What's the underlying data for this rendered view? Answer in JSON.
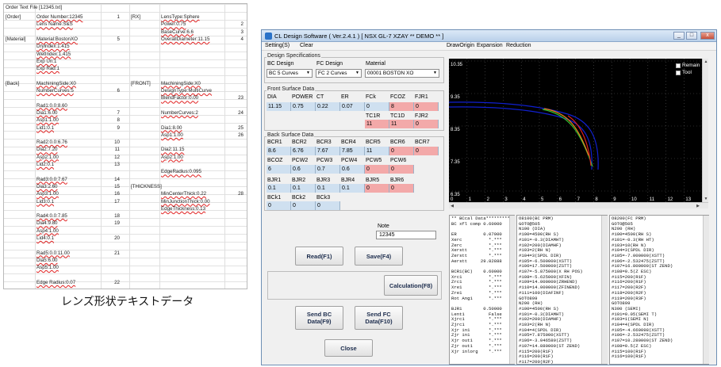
{
  "sheet": {
    "title": "Order Text File [12345.txt]",
    "rows": [
      {
        "a": "[Order]",
        "b": "Order Number:12345",
        "n": "1",
        "c": "[RX]",
        "d": "LensType:Sphere",
        "e": ""
      },
      {
        "a": "",
        "b": "Lens Name:S&S",
        "n": "",
        "c": "",
        "d": "Power:0.75",
        "e": "2"
      },
      {
        "a": "",
        "b": "",
        "n": "",
        "c": "",
        "d": "BaseCurve:6.6",
        "e": "3"
      },
      {
        "a": "[Material]",
        "b": "Material:BostonXO",
        "n": "5",
        "c": "",
        "d": "OverallDiameter:11.15",
        "e": "4"
      },
      {
        "a": "",
        "b": "Drylndex:1.415",
        "n": "",
        "c": "",
        "d": "",
        "e": ""
      },
      {
        "a": "",
        "b": "WetIndex:1.415",
        "n": "",
        "c": "",
        "d": "",
        "e": ""
      },
      {
        "a": "",
        "b": "Exp Un:1",
        "n": "",
        "c": "",
        "d": "",
        "e": ""
      },
      {
        "a": "",
        "b": "Exp Rad:1",
        "n": "",
        "c": "",
        "d": "",
        "e": ""
      },
      {
        "a": "",
        "b": "",
        "n": "",
        "c": "",
        "d": "",
        "e": ""
      },
      {
        "a": "[Back]",
        "b": "MachiningSide:X0",
        "n": "",
        "c": "[FRONT]",
        "d": "MachiningSide:X0",
        "e": ""
      },
      {
        "a": "",
        "b": "NumberCurves:5",
        "n": "6",
        "c": "",
        "d": "DesignType:MultiCurve",
        "e": ""
      },
      {
        "a": "",
        "b": "",
        "n": "",
        "c": "",
        "d": "BlendFactor:0.00",
        "e": "23"
      },
      {
        "a": "",
        "b": "Rad1:0.0:8.60",
        "n": "",
        "c": "",
        "d": "",
        "e": ""
      },
      {
        "a": "",
        "b": "Dia1:6.00",
        "n": "7",
        "c": "",
        "d": "NumberCurves:2",
        "e": "24"
      },
      {
        "a": "",
        "b": "Asp1:1.00",
        "n": "8",
        "c": "",
        "d": "",
        "e": ""
      },
      {
        "a": "",
        "b": "Lid1:0.1",
        "n": "9",
        "c": "",
        "d": "Dia1:8.00",
        "e": "25"
      },
      {
        "a": "",
        "b": "",
        "n": "",
        "c": "",
        "d": "Asp1:1.00",
        "e": "26"
      },
      {
        "a": "",
        "b": "Rad2:0.0:6.76",
        "n": "10",
        "c": "",
        "d": "",
        "e": ""
      },
      {
        "a": "",
        "b": "Dia2:7.20",
        "n": "11",
        "c": "",
        "d": "Dia2:11.15",
        "e": ""
      },
      {
        "a": "",
        "b": "Asp2:1.00",
        "n": "12",
        "c": "",
        "d": "Asp2:1.00",
        "e": ""
      },
      {
        "a": "",
        "b": "Lid2:0.1",
        "n": "13",
        "c": "",
        "d": "",
        "e": ""
      },
      {
        "a": "",
        "b": "",
        "n": "",
        "c": "",
        "d": "EdgeRadius:0.095",
        "e": ""
      },
      {
        "a": "",
        "b": "Rad3:0.0:7.67",
        "n": "14",
        "c": "",
        "d": "",
        "e": ""
      },
      {
        "a": "",
        "b": "Dia3:2.60",
        "n": "15",
        "c": "[THICKNESS]",
        "d": "",
        "e": ""
      },
      {
        "a": "",
        "b": "Asp3:1.00",
        "n": "16",
        "c": "",
        "d": "MinCenterThick:0.22",
        "e": "28"
      },
      {
        "a": "",
        "b": "Lid3:0.1",
        "n": "17",
        "c": "",
        "d": "MinJunctionThick:0.00",
        "e": ""
      },
      {
        "a": "",
        "b": "",
        "n": "",
        "c": "",
        "d": "EdgeThickness:0.13",
        "e": ""
      },
      {
        "a": "",
        "b": "Rad4:0.0:7.85",
        "n": "18",
        "c": "",
        "d": "",
        "e": ""
      },
      {
        "a": "",
        "b": "Dia4:9.80",
        "n": "19",
        "c": "",
        "d": "",
        "e": ""
      },
      {
        "a": "",
        "b": "Asp4:1.00",
        "n": "",
        "c": "",
        "d": "",
        "e": ""
      },
      {
        "a": "",
        "b": "Lid4:0.1",
        "n": "20",
        "c": "",
        "d": "",
        "e": ""
      },
      {
        "a": "",
        "b": "",
        "n": "",
        "c": "",
        "d": "",
        "e": ""
      },
      {
        "a": "",
        "b": "Rad5:0.0:11.00",
        "n": "21",
        "c": "",
        "d": "",
        "e": ""
      },
      {
        "a": "",
        "b": "Dia5:6.00",
        "n": "",
        "c": "",
        "d": "",
        "e": ""
      },
      {
        "a": "",
        "b": "Asp5:1.00",
        "n": "",
        "c": "",
        "d": "",
        "e": ""
      },
      {
        "a": "",
        "b": "",
        "n": "",
        "c": "",
        "d": "",
        "e": ""
      },
      {
        "a": "",
        "b": "Edge Radius:0.07",
        "n": "22",
        "c": "",
        "d": "",
        "e": ""
      }
    ]
  },
  "caption": "レンズ形状テキストデータ",
  "window": {
    "title": "CL Design Software ( Ver.2.4.1 )  [ NSX GL-7 XZAY ** DEMO ** ]",
    "buttons": {
      "min": "_",
      "max": "□",
      "close": "x"
    },
    "menu_left": [
      "Setting(S)",
      "Clear"
    ],
    "menu_right": [
      "DrawOrigin",
      "Expansion",
      "Reduction"
    ],
    "spec": {
      "group": "Design Specifications",
      "bc_label": "BC Design",
      "fc_label": "FC Design",
      "mat_label": "Material",
      "bc_value": "BC 5 Curves",
      "fc_value": "FC 2 Curves",
      "mat_value": "00001 BOSTON XO"
    },
    "front": {
      "group": "Front Surface Data",
      "headers": [
        "DIA",
        "POWER",
        "CT",
        "ER",
        "FCk",
        "FCOZ",
        "FJR1"
      ],
      "values": [
        "11.15",
        "0.75",
        "0.22",
        "0.07",
        "0",
        "8",
        "0"
      ],
      "headers2": [
        "TC1R",
        "TC1D",
        "FJR2"
      ],
      "values2": [
        "11",
        "11",
        "0"
      ]
    },
    "back": {
      "group": "Back Surface Data",
      "bcr_headers": [
        "BCR1",
        "BCR2",
        "BCR3",
        "BCR4",
        "BCR5",
        "BCR6",
        "BCR7"
      ],
      "bcr_values": [
        "8.6",
        "6.76",
        "7.67",
        "7.85",
        "11",
        "0",
        "0"
      ],
      "bcoz_headers": [
        "BCOZ",
        "PCW2",
        "PCW3",
        "PCW4",
        "PCW5",
        "PCW6"
      ],
      "bcoz_values": [
        "6",
        "0.6",
        "0.7",
        "0.6",
        "0",
        "0"
      ],
      "bjr_headers": [
        "BJR1",
        "BJR2",
        "BJR3",
        "BJR4",
        "BJR5",
        "BJR6"
      ],
      "bjr_values": [
        "0.1",
        "0.1",
        "0.1",
        "0.1",
        "0",
        "0"
      ],
      "bck_headers": [
        "BCk1",
        "BCk2",
        "BCk3"
      ],
      "bck_values": [
        "0",
        "0",
        "0"
      ]
    },
    "note": {
      "label": "Note",
      "value": "12345"
    },
    "actions": {
      "read": "Read(F1)",
      "save": "Save(F4)",
      "calc": "Calculation(F8)",
      "send_bc": "Send BC\nData(F9)",
      "send_fc": "Send FC\nData(F10)",
      "close": "Close"
    },
    "plot": {
      "remain": "Remain",
      "tool": "Tool",
      "y_ticks": [
        "10.35",
        "9.35",
        "8.35",
        "7.35",
        "6.35"
      ],
      "x_ticks": [
        "0",
        "1",
        "2",
        "3",
        "4",
        "5",
        "6",
        "7",
        "8",
        "9",
        "10",
        "11",
        "12",
        "13",
        "14"
      ],
      "colors": {
        "blue": "#1020d0",
        "orange": "#f08020",
        "green": "#30c030",
        "red": "#e02020"
      }
    },
    "pane1": "** BCcal Data*********\nBC xfl comp 0.60000\n\nER          0.07000\nXerc          *.***\nZerc          *.***\nXerstt        *.***\nZerstt        *.***\nAerstt     29.82888\n\nBCR1(BC)    0.60000\nXrc1          *.***\nZrc1          *.***\nXre1          *.***\nZre1          *.***\nRot Ang1      *.***\n\nBJR1        0.50000\nLent1         False\nXjrc1         *.***\nZjrc1         *.***\nXjr in1       *.***\nZjr in1       *.***\nXjr out1      *.***\nZjr out1      *.***\nXjr inlorg    *.***",
    "pane2": "O8100(BC PRM)\nGOTO@505\nN100 (DIA)\n#100=4500(RH S)\n#101=-0.3(DIAMHT)\n#102=200(DIAMHF)\n#103=2(RH N)\n#104=3(SPDL DIR)\n#105=-6.500000(XSTT)\n#106=17.500000(ZSTT)\n#107=-5.875000(X RH POS)\n#108=-5.625000(XFIN)\n#109=14.000000(ZRHEND)\n#110=14.000000(ZFINEND)\n#111=100(DIAFINF)\nGOTO899\nN200 (RH)\n#100=4500(RH S)\n#101=-0.3(DIAMHT)\n#102=200(DIAMHF)\n#103=2(RH N)\n#104=4(SPDL DIR)\n#105=7.875000(XSTT)\n#106=-3.046589(ZSTT)\n#107=14.880000(ST ZEND)\n#115=200(R1F)\n#116=200(R1F)\n#117=200(R2F)",
    "pane3": "O8200(FC PRM)\nGOTO@505\nN200 (RH)\n#100=4500(RH S)\n#101=-0.3(RH HT)\n#103=10(RH N)\n#104=3(SPDL DIR)\n#105=-7.000000(XSTT)\n#106=-2.532475(ZSTT)\n#107=16.800000(ST ZEND)\n#108=0.5(Z ESC)\n#115=200(R1F)\n#116=200(R1F)\n#117=200(R2F)\n#118=200(R2F)\n#119=200(R3F)\nGOTO899\nN300 (SEMI)\n#101=0.05(SEMI T)\n#103=1(SEMI N)\n#104=4(SPDL DIR)\n#105=-4.660098(XSTT)\n#106=-2.532475(ZSTT)\n#107=10.280000(ST ZEND)\n#108=0.5(Z ESC)\n#115=100(R1F)\n#116=100(R1F)"
  }
}
